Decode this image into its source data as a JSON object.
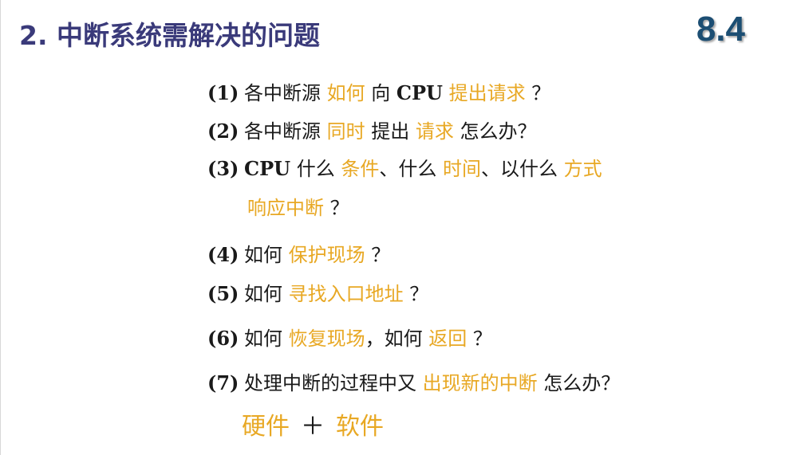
{
  "header": {
    "title": "2.  中断系统需解决的问题",
    "section": "8.4"
  },
  "questions": [
    {
      "num": "(1)",
      "t1": "各中断源 ",
      "h1": "如何",
      "t2": " 向 ",
      "b1": "CPU",
      "t3": " ",
      "h2": "提出请求",
      "t4": " ？"
    },
    {
      "num": "(2)",
      "t1": "各中断源 ",
      "h1": "同时",
      "t2": " 提出 ",
      "h2": "请求",
      "t3": " 怎么办？"
    },
    {
      "num": "(3)",
      "b1": "CPU",
      "t1": " 什么 ",
      "h1": "条件",
      "t2": "、什么 ",
      "h2": "时间",
      "t3": "、以什么 ",
      "h3": "方式",
      "cont_h": "响应中断",
      "cont_t": " ？"
    },
    {
      "num": "(4)",
      "t1": "如何 ",
      "h1": "保护现场",
      "t2": " ？"
    },
    {
      "num": "(5)",
      "t1": "如何 ",
      "h1": "寻找入口地址",
      "t2": " ？"
    },
    {
      "num": "(6)",
      "t1": "如何 ",
      "h1": "恢复现场",
      "t2": "，如何 ",
      "h2": "返回",
      "t3": " ？"
    },
    {
      "num": "(7)",
      "t1": "处理中断的过程中又 ",
      "h1": "出现新的中断",
      "t2": " 怎么办？"
    }
  ],
  "answer": {
    "left": "硬件",
    "plus": "＋",
    "right": "软件"
  },
  "colors": {
    "title": "#3a3a7a",
    "section": "#1c4e73",
    "highlight": "#e8a824",
    "text": "#1a1a1a"
  }
}
